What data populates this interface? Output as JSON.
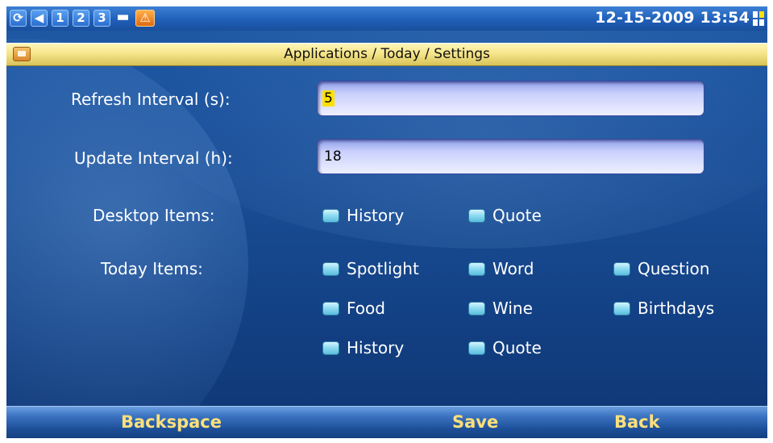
{
  "status_bar": {
    "icons": [
      {
        "name": "sync-icon",
        "glyph": "⟳"
      },
      {
        "name": "speaker-icon",
        "glyph": "◀"
      },
      {
        "name": "line-1-icon",
        "glyph": "1"
      },
      {
        "name": "line-2-icon",
        "glyph": "2"
      },
      {
        "name": "line-3-icon",
        "glyph": "3"
      },
      {
        "name": "folder-icon",
        "glyph": "▬"
      },
      {
        "name": "warning-icon",
        "glyph": "⚠"
      }
    ],
    "clock": "12-15-2009 13:54"
  },
  "title_bar": {
    "title": "Applications / Today / Settings"
  },
  "form": {
    "refresh_label": "Refresh Interval (s):",
    "refresh_value": "5",
    "update_label": "Update Interval (h):",
    "update_value": "18",
    "desktop_label": "Desktop Items:",
    "desktop_items": [
      "History",
      "Quote"
    ],
    "today_label": "Today Items:",
    "today_items": [
      "Spotlight",
      "Word",
      "Question",
      "Food",
      "Wine",
      "Birthdays",
      "History",
      "Quote"
    ]
  },
  "softkeys": {
    "left": "Backspace",
    "middle": "Save",
    "right": "Back"
  },
  "colors": {
    "background": "#1a4e96",
    "softkey_text": "#ffe07a",
    "title_bar": "#f6e58a",
    "field": "#c9d0fb"
  }
}
